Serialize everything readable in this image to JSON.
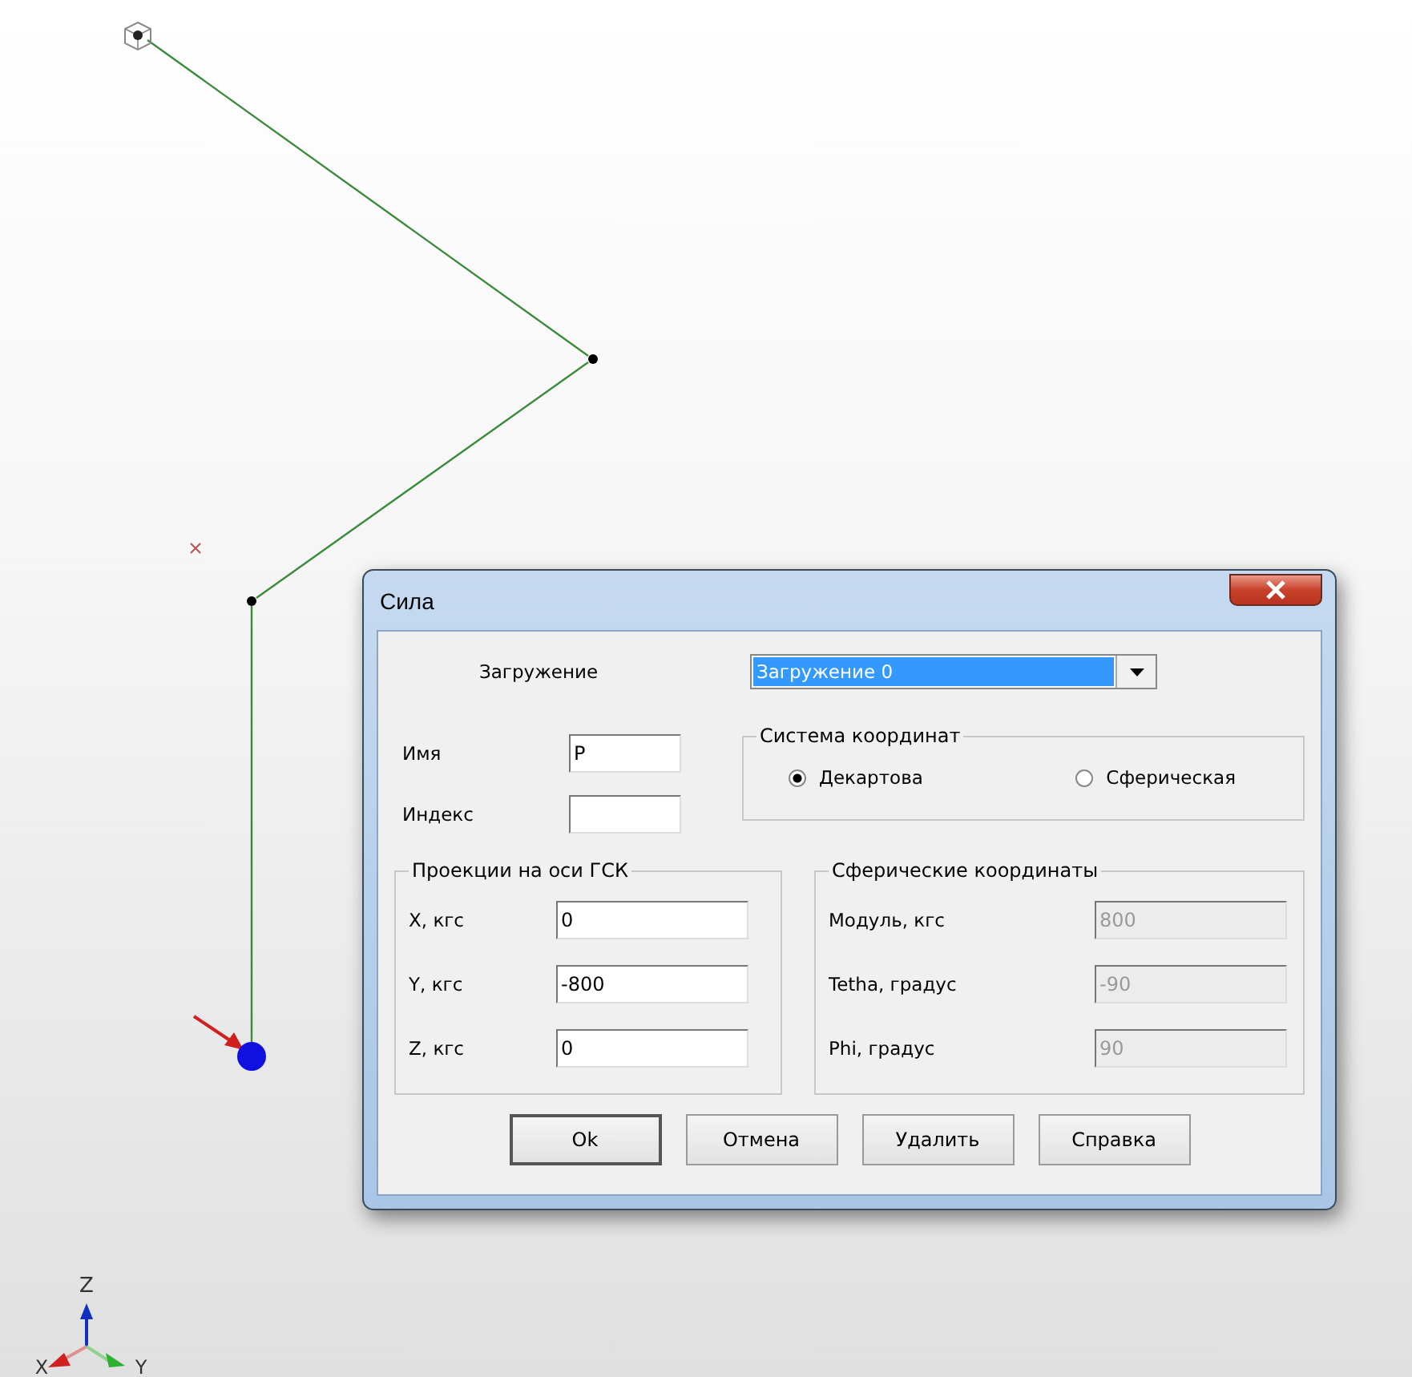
{
  "window": {
    "title": "Сила"
  },
  "load_case": {
    "label": "Загружение",
    "value": "Загружение 0"
  },
  "name": {
    "label": "Имя",
    "value": "P"
  },
  "index": {
    "label": "Индекс"
  },
  "coordinate_system": {
    "title": "Система координат",
    "options": [
      {
        "label": "Декартова",
        "selected": true
      },
      {
        "label": "Сферическая",
        "selected": false
      }
    ]
  },
  "projections": {
    "title": "Проекции на оси  ГСК",
    "fields": [
      {
        "label": "X, кгс",
        "value": "0",
        "disabled": false
      },
      {
        "label": "Y, кгс",
        "value": "-800",
        "disabled": false
      },
      {
        "label": "Z, кгс",
        "value": "0",
        "disabled": false
      }
    ]
  },
  "spherical": {
    "title": "Сферические координаты",
    "fields": [
      {
        "label": "Модуль, кгс",
        "value": "800",
        "disabled": true
      },
      {
        "label": "Tetha, градус",
        "value": "-90",
        "disabled": true
      },
      {
        "label": "Phi, градус",
        "value": "90",
        "disabled": true
      }
    ]
  },
  "buttons": [
    {
      "label": "Ok",
      "default": true
    },
    {
      "label": "Отмена",
      "default": false
    },
    {
      "label": "Удалить",
      "default": false
    },
    {
      "label": "Справка",
      "default": false
    }
  ],
  "axes": {
    "z": "Z",
    "x": "X",
    "y": "Y"
  }
}
